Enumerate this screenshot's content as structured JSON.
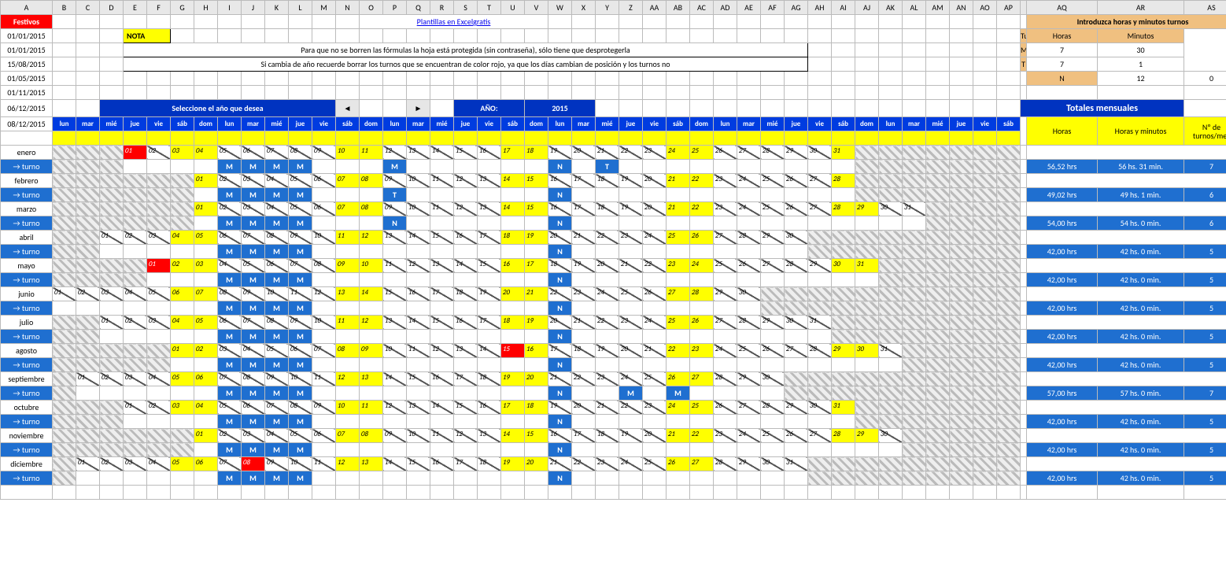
{
  "topLink": "Plantillas en Excelgratis",
  "festivosHeader": "Festivos",
  "festivos": [
    "01/01/2015",
    "01/01/2015",
    "15/08/2015",
    "01/05/2015",
    "01/11/2015",
    "06/12/2015",
    "08/12/2015"
  ],
  "notaLabel": "NOTA",
  "notaLines": [
    "Para que no se borren las fórmulas la hoja está protegida (sin contraseña), sólo tiene que desprotegerla",
    "Si cambia de año recuerde borrar los turnos que se encuentran de color rojo, ya que los días cambian de posición y los turnos no"
  ],
  "selectYearLabel": "Seleccione el año que desea",
  "yearLabel": "AÑO:",
  "year": "2015",
  "turnoTable": {
    "title": "Introduzca horas y minutos turnos",
    "headers": [
      "Turno",
      "Horas",
      "Minutos"
    ],
    "rows": [
      {
        "t": "M",
        "h": "7",
        "m": "30"
      },
      {
        "t": "T",
        "h": "7",
        "m": "1"
      },
      {
        "t": "N",
        "h": "12",
        "m": "0"
      }
    ]
  },
  "monthTotalsHeader": "Totales mensuales",
  "monthTotalsCols": [
    "Horas",
    "Horas y minutos",
    "Nº de turnos/mes"
  ],
  "dowHeaders": [
    "lun",
    "mar",
    "mié",
    "jue",
    "vie",
    "sáb",
    "dom",
    "lun",
    "mar",
    "mié",
    "jue",
    "vie",
    "sáb",
    "dom",
    "lun",
    "mar",
    "mié",
    "jue",
    "vie",
    "sáb",
    "dom",
    "lun",
    "mar",
    "mié",
    "jue",
    "vie",
    "sáb",
    "dom",
    "lun",
    "mar",
    "mié",
    "jue",
    "vie",
    "sáb",
    "dom",
    "lun",
    "mar",
    "mié",
    "jue",
    "vie",
    "sáb"
  ],
  "turnoRowLabel": "→ turno",
  "columnLetters": [
    "A",
    "B",
    "C",
    "D",
    "E",
    "F",
    "G",
    "H",
    "I",
    "J",
    "K",
    "L",
    "M",
    "N",
    "O",
    "P",
    "Q",
    "R",
    "S",
    "T",
    "U",
    "V",
    "W",
    "X",
    "Y",
    "Z",
    "AA",
    "AB",
    "AC",
    "AD",
    "AE",
    "AF",
    "AG",
    "AH",
    "AI",
    "AJ",
    "AK",
    "AL",
    "AM",
    "AN",
    "AO",
    "AP",
    "",
    "AQ",
    "AR",
    "AS"
  ],
  "months": [
    {
      "name": "enero",
      "startSlot": 3,
      "days": 31,
      "sundays": [
        4,
        11,
        18,
        25
      ],
      "saturdays": [
        3,
        10,
        17,
        24,
        31
      ],
      "holidays": [
        1
      ],
      "shifts": {
        "8": "M",
        "9": "M",
        "10": "M",
        "11": "M",
        "15": "M",
        "22": "N",
        "24": "T"
      },
      "tot": [
        "56,52  hrs",
        "56 hs. 31 min.",
        "7"
      ]
    },
    {
      "name": "febrero",
      "startSlot": 6,
      "days": 28,
      "sundays": [
        1,
        8,
        15,
        22
      ],
      "saturdays": [
        7,
        14,
        21,
        28
      ],
      "holidays": [],
      "shifts": {
        "8": "M",
        "9": "M",
        "10": "M",
        "11": "M",
        "15": "T",
        "22": "N"
      },
      "tot": [
        "49,02  hrs",
        "49 hs. 1 min.",
        "6"
      ]
    },
    {
      "name": "marzo",
      "startSlot": 6,
      "days": 31,
      "sundays": [
        1,
        8,
        15,
        22,
        29
      ],
      "saturdays": [
        7,
        14,
        21,
        28
      ],
      "holidays": [],
      "shifts": {
        "8": "M",
        "9": "M",
        "10": "M",
        "11": "M",
        "15": "N",
        "22": "N"
      },
      "tot": [
        "54,00  hrs",
        "54 hs. 0 min.",
        "6"
      ]
    },
    {
      "name": "abril",
      "startSlot": 2,
      "days": 30,
      "sundays": [
        5,
        12,
        19,
        26
      ],
      "saturdays": [
        4,
        11,
        18,
        25
      ],
      "holidays": [],
      "shifts": {
        "8": "M",
        "9": "M",
        "10": "M",
        "11": "M",
        "22": "N"
      },
      "tot": [
        "42,00  hrs",
        "42 hs. 0 min.",
        "5"
      ]
    },
    {
      "name": "mayo",
      "startSlot": 4,
      "days": 31,
      "sundays": [
        3,
        10,
        17,
        24,
        31
      ],
      "saturdays": [
        2,
        9,
        16,
        23,
        30
      ],
      "holidays": [
        1
      ],
      "shifts": {
        "8": "M",
        "9": "M",
        "10": "M",
        "11": "M",
        "22": "N"
      },
      "tot": [
        "42,00  hrs",
        "42 hs. 0 min.",
        "5"
      ]
    },
    {
      "name": "junio",
      "startSlot": 0,
      "days": 30,
      "sundays": [
        7,
        14,
        21,
        28
      ],
      "saturdays": [
        6,
        13,
        20,
        27
      ],
      "holidays": [],
      "shifts": {
        "8": "M",
        "9": "M",
        "10": "M",
        "11": "M",
        "22": "N"
      },
      "tot": [
        "42,00  hrs",
        "42 hs. 0 min.",
        "5"
      ]
    },
    {
      "name": "julio",
      "startSlot": 2,
      "days": 31,
      "sundays": [
        5,
        12,
        19,
        26
      ],
      "saturdays": [
        4,
        11,
        18,
        25
      ],
      "holidays": [],
      "shifts": {
        "8": "M",
        "9": "M",
        "10": "M",
        "11": "M",
        "22": "N"
      },
      "tot": [
        "42,00  hrs",
        "42 hs. 0 min.",
        "5"
      ]
    },
    {
      "name": "agosto",
      "startSlot": 5,
      "days": 31,
      "sundays": [
        2,
        9,
        16,
        23,
        30
      ],
      "saturdays": [
        1,
        8,
        15,
        22,
        29
      ],
      "holidays": [
        15
      ],
      "shifts": {
        "8": "M",
        "9": "M",
        "10": "M",
        "11": "M",
        "22": "N"
      },
      "tot": [
        "42,00  hrs",
        "42 hs. 0 min.",
        "5"
      ]
    },
    {
      "name": "septiembre",
      "startSlot": 1,
      "days": 30,
      "sundays": [
        6,
        13,
        20,
        27
      ],
      "saturdays": [
        5,
        12,
        19,
        26
      ],
      "holidays": [],
      "shifts": {
        "8": "M",
        "9": "M",
        "10": "M",
        "11": "M",
        "22": "N",
        "25": "M",
        "27": "M"
      },
      "tot": [
        "57,00  hrs",
        "57 hs. 0 min.",
        "7"
      ]
    },
    {
      "name": "octubre",
      "startSlot": 3,
      "days": 31,
      "sundays": [
        4,
        11,
        18,
        25
      ],
      "saturdays": [
        3,
        10,
        17,
        24,
        31
      ],
      "holidays": [],
      "shifts": {
        "8": "M",
        "9": "M",
        "10": "M",
        "11": "M",
        "22": "N"
      },
      "tot": [
        "42,00  hrs",
        "42 hs. 0 min.",
        "5"
      ]
    },
    {
      "name": "noviembre",
      "startSlot": 6,
      "days": 30,
      "sundays": [
        1,
        8,
        15,
        22,
        29
      ],
      "saturdays": [
        7,
        14,
        21,
        28
      ],
      "holidays": [],
      "shifts": {
        "8": "M",
        "9": "M",
        "10": "M",
        "11": "M",
        "22": "N"
      },
      "tot": [
        "42,00  hrs",
        "42 hs. 0 min.",
        "5"
      ]
    },
    {
      "name": "diciembre",
      "startSlot": 1,
      "days": 31,
      "sundays": [
        6,
        13,
        20,
        27
      ],
      "saturdays": [
        5,
        12,
        19,
        26
      ],
      "holidays": [
        8
      ],
      "shifts": {
        "8": "M",
        "9": "M",
        "10": "M",
        "11": "M",
        "22": "N"
      },
      "tot": [
        "42,00  hrs",
        "42 hs. 0 min.",
        "5"
      ]
    }
  ]
}
